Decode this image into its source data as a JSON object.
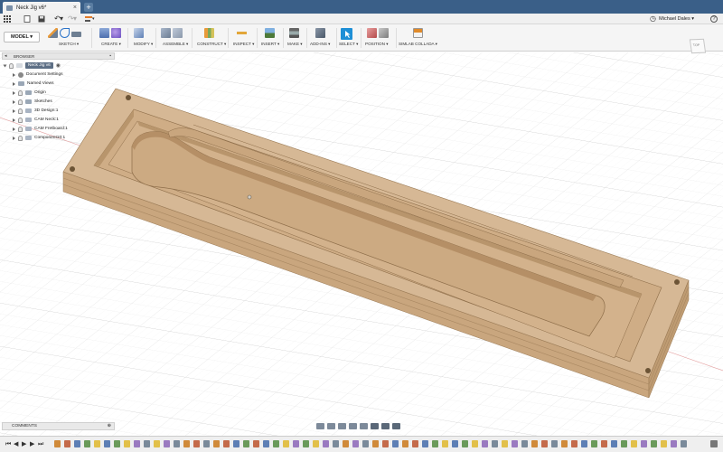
{
  "document": {
    "tab_title": "Neck Jig v6*",
    "close_glyph": "×",
    "new_tab_glyph": "+"
  },
  "quickbar": {
    "user_name": "Michael Dales ▾",
    "help_glyph": "?",
    "clock_glyph": "◷"
  },
  "toolbar": {
    "workspace": "MODEL ▾",
    "groups": [
      {
        "label": "SKETCH ▾"
      },
      {
        "label": "CREATE ▾"
      },
      {
        "label": "MODIFY ▾"
      },
      {
        "label": "ASSEMBLE ▾"
      },
      {
        "label": "CONSTRUCT ▾"
      },
      {
        "label": "INSPECT ▾"
      },
      {
        "label": "INSERT ▾"
      },
      {
        "label": "MAKE ▾"
      },
      {
        "label": "ADD-INS ▾"
      },
      {
        "label": "SELECT ▾"
      },
      {
        "label": "POSITION ▾"
      },
      {
        "label": "SIMLAB COLLADA ▾"
      }
    ],
    "accent": "#1e8fd6"
  },
  "viewcube": {
    "label": "TOP"
  },
  "browser": {
    "title": "BROWSER",
    "collapse_glyph": "◂",
    "items": [
      {
        "label": "Neck Jig v6",
        "root": true
      },
      {
        "label": "Document Settings"
      },
      {
        "label": "Named Views"
      },
      {
        "label": "Origin"
      },
      {
        "label": "Sketches"
      },
      {
        "label": "3D Design:1"
      },
      {
        "label": "CAM Neck:1"
      },
      {
        "label": "CAM Fretboard:1"
      },
      {
        "label": "Component10:1"
      }
    ]
  },
  "comments": {
    "title": "COMMENTS",
    "toggle_glyph": "⊕"
  },
  "timeline": {
    "controls": [
      "⏮",
      "◀",
      "▶",
      "▶",
      "⏭"
    ]
  },
  "colors": {
    "wood_top": "#d6b895",
    "wood_side": "#c9a67e",
    "wood_edge": "#a88761",
    "pocket_floor": "#d1b08a",
    "title_bar": "#3a5f88"
  }
}
